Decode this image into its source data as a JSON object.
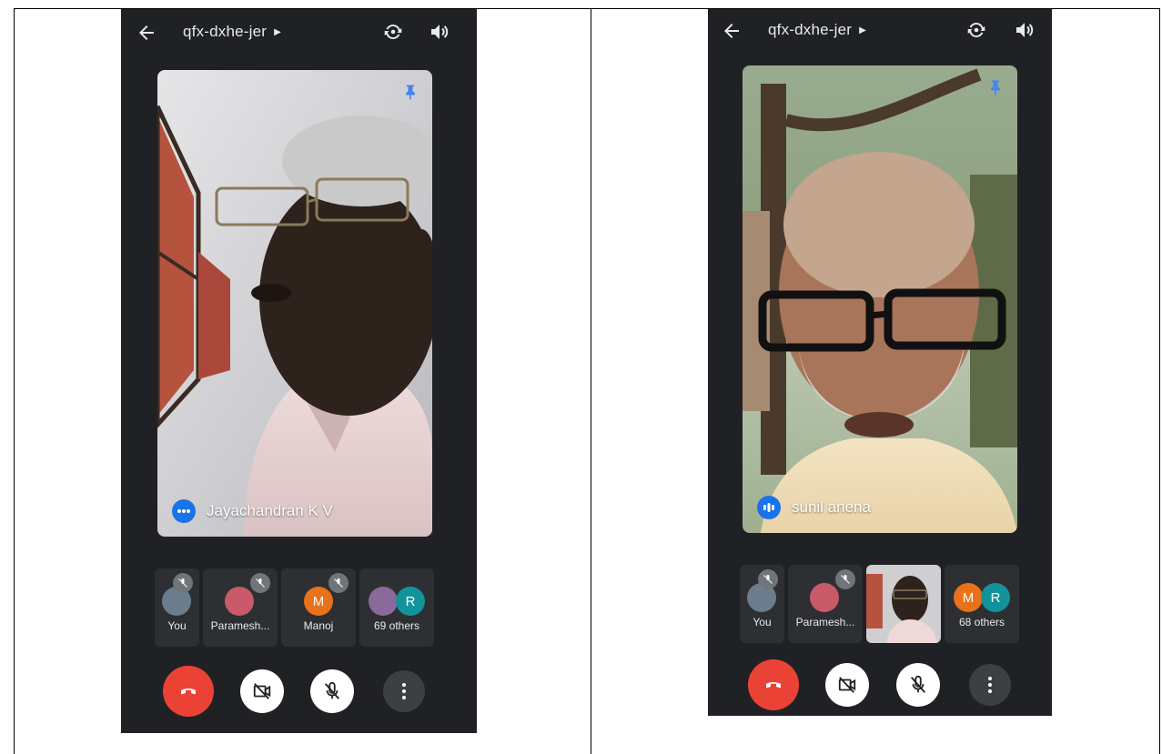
{
  "left": {
    "meeting_code": "qfx-dxhe-jer",
    "main_speaker": "Jayachandran K V",
    "tiles": [
      {
        "label": "You"
      },
      {
        "label": "Paramesh..."
      },
      {
        "label": "Manoj",
        "initial": "M",
        "color": "#e8711a"
      },
      {
        "label": "69 others",
        "initial": "R",
        "color": "#12939a"
      }
    ]
  },
  "right": {
    "meeting_code": "qfx-dxhe-jer",
    "main_speaker": "sunil anena",
    "tiles": [
      {
        "label": "You"
      },
      {
        "label": "Paramesh..."
      },
      {
        "label": ""
      },
      {
        "label": "68 others",
        "initial_a": "M",
        "initial_b": "R",
        "color_a": "#e8711a",
        "color_b": "#12939a"
      }
    ]
  },
  "colors": {
    "app_bg": "#202124",
    "end_call": "#ea4335",
    "accent": "#1a73e8"
  }
}
